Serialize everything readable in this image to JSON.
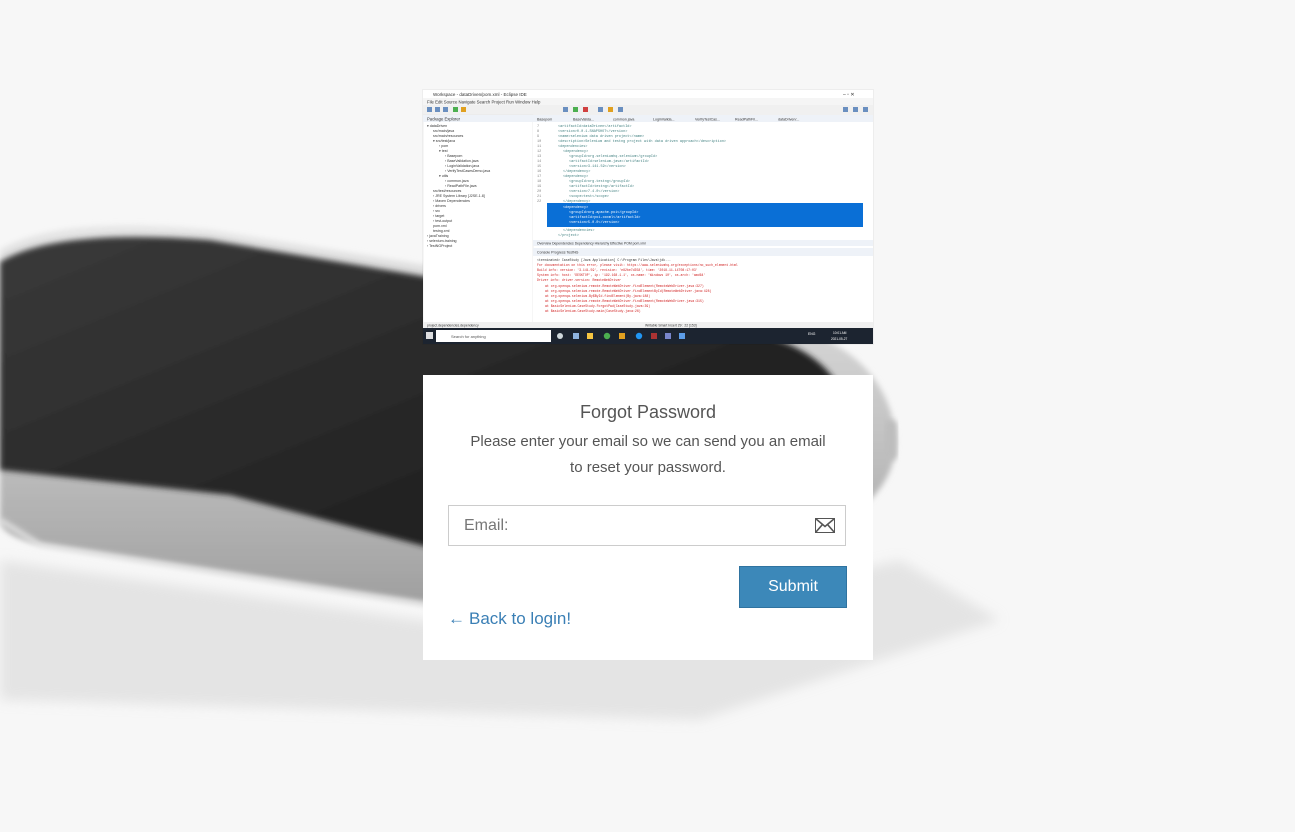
{
  "thumbnail": {
    "window_title": "Workspace - dataDriven/pom.xml - Eclipse IDE",
    "menu": [
      "File",
      "Edit",
      "Source",
      "Navigate",
      "Search",
      "Project",
      "Run",
      "Window",
      "Help"
    ],
    "panel_title": "Package Explorer",
    "taskbar_search": "Search for anything"
  },
  "form": {
    "title": "Forgot Password",
    "subtitle": "Please enter your email so we can send you an email to reset your password.",
    "email_placeholder": "Email:",
    "submit_label": "Submit",
    "back_arrow": "←",
    "back_label": "Back to login!"
  },
  "colors": {
    "accent": "#3c88b9",
    "link": "#3a7fb5",
    "text": "#555555"
  }
}
